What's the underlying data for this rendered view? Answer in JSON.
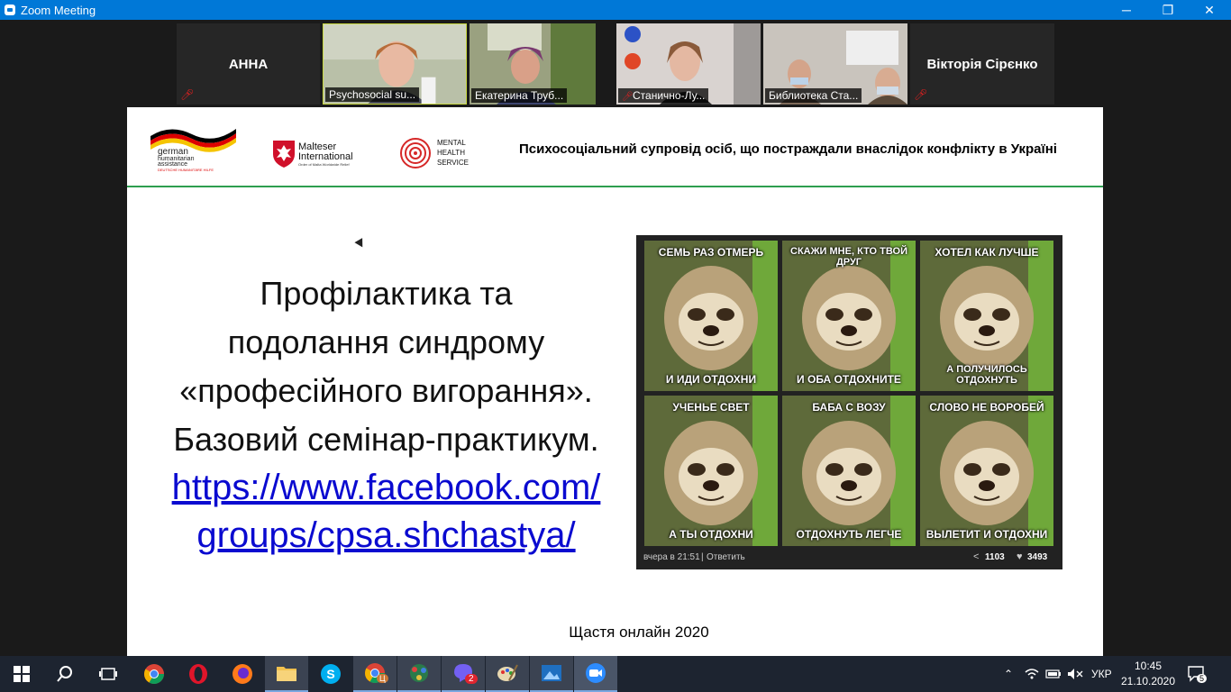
{
  "window": {
    "title": "Zoom Meeting",
    "minimize": "─",
    "restore": "❐",
    "close": "✕"
  },
  "participants": [
    {
      "name": "АННА",
      "video": false
    },
    {
      "name": "Psychosocial su...",
      "video": true
    },
    {
      "name": "Екатерина Труб...",
      "video": true
    },
    {
      "name": "Станично-Лу...",
      "video": true
    },
    {
      "name": "Библиотека Ста...",
      "video": true
    },
    {
      "name": "Вікторія Сірєнко",
      "video": false
    }
  ],
  "slide": {
    "logos": {
      "gha": [
        "german",
        "humanitarian",
        "assistance",
        "DEUTSCHE HUMANITÄRE HILFE"
      ],
      "malteser": [
        "Malteser",
        "International",
        "Order of Malta Worldwide Relief"
      ],
      "mhs": [
        "MENTAL",
        "HEALTH",
        "SERVICE"
      ]
    },
    "header_title": "Психосоціальний супровід осіб, що постраждали внаслідок конфлікту в Україні",
    "title_lines": [
      "Профілактика та",
      "подолання синдрому",
      "«професійного вигорання».",
      "Базовий семінар-практикум."
    ],
    "link_lines": [
      "https://www.facebook.com/",
      "groups/cpsa.shchastya/"
    ],
    "footer": "Щастя онлайн 2020"
  },
  "meme": {
    "cells": [
      {
        "top": "СЕМЬ РАЗ ОТМЕРЬ",
        "bottom": "И ИДИ ОТДОХНИ"
      },
      {
        "top": "СКАЖИ МНЕ, КТО ТВОЙ ДРУГ",
        "bottom": "И ОБА ОТДОХНИТЕ"
      },
      {
        "top": "ХОТЕЛ КАК ЛУЧШЕ",
        "bottom": "А ПОЛУЧИЛОСЬ ОТДОХНУТЬ"
      },
      {
        "top": "УЧЕНЬЕ СВЕТ",
        "bottom": "А ТЫ ОТДОХНИ"
      },
      {
        "top": "БАБА С ВОЗУ",
        "bottom": "ОТДОХНУТЬ ЛЕГЧЕ"
      },
      {
        "top": "СЛОВО НЕ ВОРОБЕЙ",
        "bottom": "ВЫЛЕТИТ И ОТДОХНИ"
      }
    ],
    "footer_time": "вчера в 21:51",
    "footer_reply": "Ответить",
    "shares": "1103",
    "likes": "3493"
  },
  "taskbar": {
    "viber_badge": "2",
    "chrome_badge": "Ц",
    "language": "УКР",
    "time": "10:45",
    "date": "21.10.2020",
    "notifications": "5"
  },
  "colors": {
    "titlebar": "#0078d7",
    "header_rule": "#2e9e4f",
    "link": "#0a0ad0",
    "taskbar": "#1d2430"
  }
}
